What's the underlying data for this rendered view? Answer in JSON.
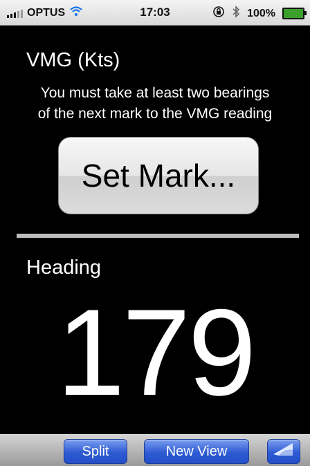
{
  "status_bar": {
    "carrier": "OPTUS",
    "time": "17:03",
    "battery": "100%",
    "icons": [
      "signal-icon",
      "wifi-icon",
      "lock-rotation-icon",
      "bluetooth-icon",
      "battery-icon"
    ]
  },
  "main": {
    "title": "VMG (Kts)",
    "hint_line1": "You must take at least two bearings",
    "hint_line2": "of the next mark to the VMG reading",
    "set_mark_label": "Set Mark...",
    "heading_label": "Heading",
    "heading_value": "179"
  },
  "toolbar": {
    "split_label": "Split",
    "new_view_label": "New View",
    "curl_icon": "page-curl-icon"
  },
  "colors": {
    "background": "#000000",
    "toolbar_button": "#2e5bd3",
    "battery_fill": "#3aa02b"
  }
}
